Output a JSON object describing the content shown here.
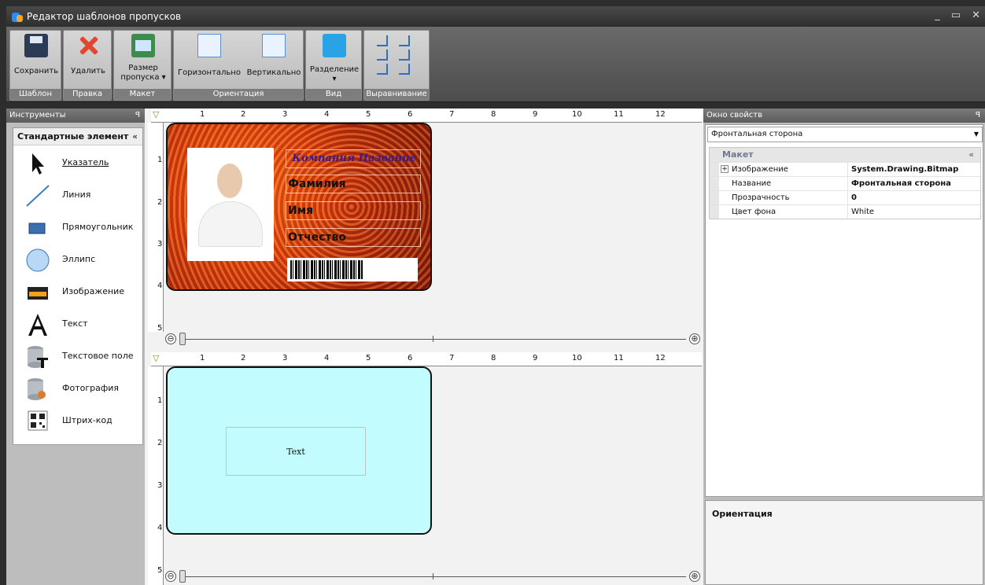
{
  "window": {
    "title": "Редактор шаблонов пропусков",
    "controls": [
      "_",
      "▭",
      "✕"
    ]
  },
  "ribbon": {
    "groups": [
      {
        "label": "Шаблон",
        "buttons": [
          "Сохранить"
        ]
      },
      {
        "label": "Правка",
        "buttons": [
          "Удалить"
        ]
      },
      {
        "label": "Макет",
        "buttons": [
          "Размер пропуска"
        ]
      },
      {
        "label": "Ориентация",
        "buttons": [
          "Горизонтально",
          "Вертикально"
        ]
      },
      {
        "label": "Вид",
        "buttons": [
          "Разделение"
        ]
      },
      {
        "label": "Выравнивание",
        "buttons": []
      }
    ],
    "size_line1": "Размер",
    "size_line2": "пропуска ▾",
    "split_arrow": "▾"
  },
  "tools": {
    "header": "Инструменты",
    "pin": "ꟼ",
    "section": "Стандартные элемент",
    "section_chevron": "«",
    "items": [
      {
        "label": "Указатель",
        "icon": "pointer-icon"
      },
      {
        "label": "Линия",
        "icon": "line-icon"
      },
      {
        "label": "Прямоугольник",
        "icon": "rectangle-icon"
      },
      {
        "label": "Эллипс",
        "icon": "ellipse-icon"
      },
      {
        "label": "Изображение",
        "icon": "image-icon"
      },
      {
        "label": "Текст",
        "icon": "text-icon"
      },
      {
        "label": "Текстовое поле",
        "icon": "database-text-icon"
      },
      {
        "label": "Фотография",
        "icon": "database-photo-icon"
      },
      {
        "label": "Штрих-код",
        "icon": "qr-code-icon"
      }
    ]
  },
  "canvas": {
    "h_ticks": [
      "1",
      "2",
      "3",
      "4",
      "5",
      "6",
      "7",
      "8",
      "9",
      "10",
      "11",
      "12"
    ],
    "v_ticks_front": [
      "1",
      "2",
      "3",
      "4",
      "5"
    ],
    "v_ticks_back": [
      "1",
      "2",
      "3",
      "4",
      "5"
    ],
    "front": {
      "company": "Компания Название",
      "lastname": "Фамилия",
      "firstname": "Имя",
      "middlename": "Отчество"
    },
    "back": {
      "text": "Text"
    },
    "zoom_minus": "⊖",
    "zoom_plus": "⊕"
  },
  "props": {
    "header": "Окно свойств",
    "pin": "ꟼ",
    "selected": "Фронтальная сторона",
    "category": "Макет",
    "category_chevron": "«",
    "rows": [
      {
        "name": "Изображение",
        "value": "System.Drawing.Bitmap",
        "bold": true,
        "expand": "+"
      },
      {
        "name": "Название",
        "value": "Фронтальная сторона",
        "bold": true
      },
      {
        "name": "Прозрачность",
        "value": "0",
        "bold": true
      },
      {
        "name": "Цвет фона",
        "value": "White",
        "bold": false
      }
    ],
    "description_title": "Ориентация"
  }
}
